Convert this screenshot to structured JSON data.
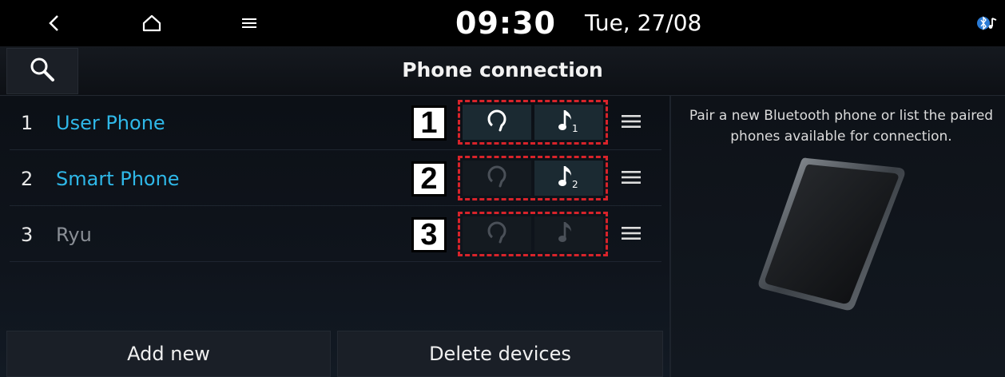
{
  "status_bar": {
    "time": "09:30",
    "date": "Tue, 27/08"
  },
  "header": {
    "title": "Phone connection"
  },
  "devices": [
    {
      "index": "1",
      "name": "User Phone",
      "status": "connected",
      "callout": "1",
      "call_active": true,
      "audio_active": true,
      "audio_sub": "1"
    },
    {
      "index": "2",
      "name": "Smart Phone",
      "status": "connected",
      "callout": "2",
      "call_active": false,
      "audio_active": true,
      "audio_sub": "2"
    },
    {
      "index": "3",
      "name": "Ryu",
      "status": "disconnected",
      "callout": "3",
      "call_active": false,
      "audio_active": false,
      "audio_sub": ""
    }
  ],
  "actions": {
    "add_new": "Add new",
    "delete_devices": "Delete devices"
  },
  "info": {
    "description": "Pair a new Bluetooth phone or list the paired phones available for connection."
  },
  "colors": {
    "active_name": "#2fb8e8",
    "inactive_name": "#8a8f96",
    "callout_border": "#d8232a"
  },
  "icons": {
    "back": "back-icon",
    "home": "home-icon",
    "menu": "menu-icon",
    "bluetooth_audio": "bluetooth-audio-icon",
    "search": "search-icon",
    "call": "handsfree-call-icon",
    "audio": "music-note-icon",
    "row_menu": "hamburger-menu-icon"
  }
}
